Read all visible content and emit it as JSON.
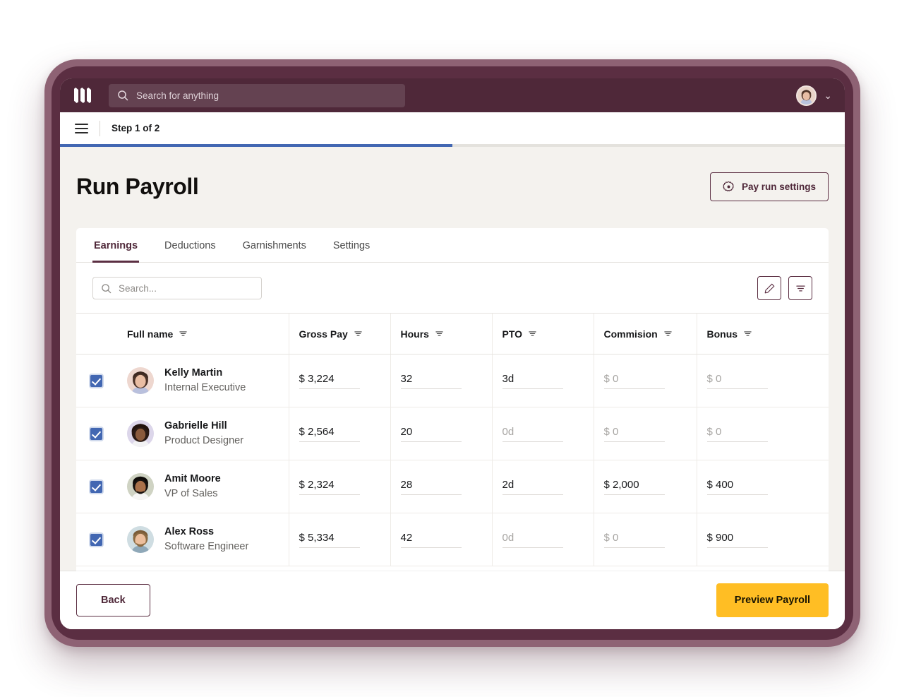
{
  "appbar": {
    "logo_name": "remote-logo",
    "search_placeholder": "Search for anything",
    "account_chevron": "⌄"
  },
  "stepbar": {
    "label": "Step 1 of 2",
    "progress_percent": 50
  },
  "header": {
    "title": "Run Payroll",
    "settings_button": "Pay run settings"
  },
  "tabs": [
    {
      "label": "Earnings",
      "active": true
    },
    {
      "label": "Deductions",
      "active": false
    },
    {
      "label": "Garnishments",
      "active": false
    },
    {
      "label": "Settings",
      "active": false
    }
  ],
  "toolbar": {
    "search_placeholder": "Search...",
    "edit_button": "edit",
    "filter_button": "filter"
  },
  "table": {
    "columns": [
      "",
      "Full name",
      "Gross Pay",
      "Hours",
      "PTO",
      "Commision",
      "Bonus"
    ],
    "rows": [
      {
        "checked": true,
        "name": "Kelly Martin",
        "role": "Internal Executive",
        "gross_pay": "$ 3,224",
        "gross_pay_muted": false,
        "hours": "32",
        "hours_muted": false,
        "pto": "3d",
        "pto_muted": false,
        "commision": "$ 0",
        "commision_muted": true,
        "bonus": "$ 0",
        "bonus_muted": true
      },
      {
        "checked": true,
        "name": "Gabrielle Hill",
        "role": "Product Designer",
        "gross_pay": "$ 2,564",
        "gross_pay_muted": false,
        "hours": "20",
        "hours_muted": false,
        "pto": "0d",
        "pto_muted": true,
        "commision": "$ 0",
        "commision_muted": true,
        "bonus": "$ 0",
        "bonus_muted": true
      },
      {
        "checked": true,
        "name": "Amit Moore",
        "role": "VP of Sales",
        "gross_pay": "$ 2,324",
        "gross_pay_muted": false,
        "hours": "28",
        "hours_muted": false,
        "pto": "2d",
        "pto_muted": false,
        "commision": "$ 2,000",
        "commision_muted": false,
        "bonus": "$ 400",
        "bonus_muted": false
      },
      {
        "checked": true,
        "name": "Alex Ross",
        "role": "Software Engineer",
        "gross_pay": "$ 5,334",
        "gross_pay_muted": false,
        "hours": "42",
        "hours_muted": false,
        "pto": "0d",
        "pto_muted": true,
        "commision": "$ 0",
        "commision_muted": true,
        "bonus": "$ 900",
        "bonus_muted": false
      }
    ]
  },
  "footer": {
    "back_button": "Back",
    "primary_button": "Preview Payroll"
  },
  "colors": {
    "brand_dark": "#4f2839",
    "device_frame": "#5b2e42",
    "accent_yellow": "#ffbe24",
    "progress_blue": "#4267b2",
    "page_bg": "#f4f2ee"
  }
}
